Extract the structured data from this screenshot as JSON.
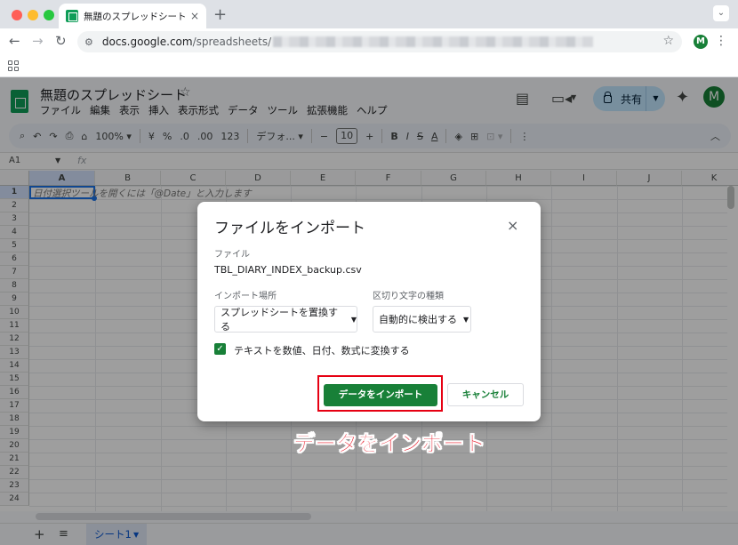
{
  "browser": {
    "tab_title": "無題のスプレッドシート - Google",
    "tab_close": "×",
    "new_tab": "+",
    "url_host": "docs.google.com",
    "url_path": "/spreadsheets/",
    "profile_initial": "M"
  },
  "sheets": {
    "doc_title": "無題のスプレッドシート",
    "title_star": "☆",
    "menus": [
      "ファイル",
      "編集",
      "表示",
      "挿入",
      "表示形式",
      "データ",
      "ツール",
      "拡張機能",
      "ヘルプ"
    ],
    "share_label": "共有",
    "avatar_initial": "M",
    "toolbar": {
      "zoom": "100%",
      "currency": "¥",
      "percent": "%",
      "dec_decrease": ".0",
      "dec_increase": ".00",
      "number_format": "123",
      "font": "デフォ...",
      "font_size": "10"
    },
    "name_box": "A1",
    "fx": "fx",
    "columns": [
      "A",
      "B",
      "C",
      "D",
      "E",
      "F",
      "G",
      "H",
      "I",
      "J",
      "K"
    ],
    "rows": [
      "1",
      "2",
      "3",
      "4",
      "5",
      "6",
      "7",
      "8",
      "9",
      "10",
      "11",
      "12",
      "13",
      "14",
      "15",
      "16",
      "17",
      "18",
      "19",
      "20",
      "21",
      "22",
      "23",
      "24"
    ],
    "cell_hint": "日付選択ツールを開くには「@Date」と入力します",
    "sheet_tab": "シート1"
  },
  "dialog": {
    "title": "ファイルをインポート",
    "close": "×",
    "file_label": "ファイル",
    "file_name": "TBL_DIARY_INDEX_backup.csv",
    "import_location_label": "インポート場所",
    "import_location_value": "スプレッドシートを置換する",
    "separator_label": "区切り文字の種類",
    "separator_value": "自動的に検出する",
    "convert_checked": true,
    "convert_label": "テキストを数値、日付、数式に変換する",
    "import_button": "データをインポート",
    "cancel_button": "キャンセル"
  },
  "annotation": "データをインポート",
  "colors": {
    "primary_green": "#188038",
    "highlight_red": "#e60012",
    "share_blue": "#c2e7ff"
  }
}
